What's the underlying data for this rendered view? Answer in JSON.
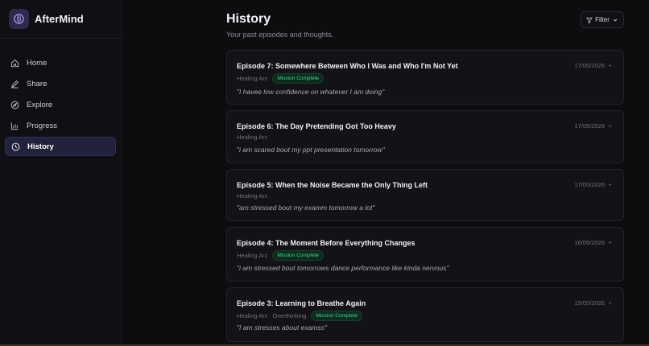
{
  "app": {
    "name": "AfterMind"
  },
  "sidebar": {
    "items": [
      {
        "label": "Home",
        "icon": "home-icon"
      },
      {
        "label": "Share",
        "icon": "pencil-icon"
      },
      {
        "label": "Explore",
        "icon": "compass-icon"
      },
      {
        "label": "Progress",
        "icon": "bar-chart-icon"
      },
      {
        "label": "History",
        "icon": "clock-icon",
        "active": true
      }
    ]
  },
  "header": {
    "title": "History",
    "subtitle": "Your past episodes and thoughts.",
    "filter_label": "Filter"
  },
  "episodes": [
    {
      "title": "Episode 7: Somewhere Between Who I Was and Who I'm Not Yet",
      "date": "17/05/2026",
      "tags": [
        "Healing Arc"
      ],
      "badge": "Mission Complete",
      "quote": "\"I havee low confidence on whatever I am doing\""
    },
    {
      "title": "Episode 6: The Day Pretending Got Too Heavy",
      "date": "17/05/2026",
      "tags": [
        "Healing Arc"
      ],
      "badge": "",
      "quote": "\"i am scared bout my ppt presentation tomorrow\""
    },
    {
      "title": "Episode 5: When the Noise Became the Only Thing Left",
      "date": "17/05/2026",
      "tags": [
        "Healing Arc"
      ],
      "badge": "",
      "quote": "\"am stressed bout my examm tomorrow a lot\""
    },
    {
      "title": "Episode 4: The Moment Before Everything Changes",
      "date": "16/05/2026",
      "tags": [
        "Healing Arc"
      ],
      "badge": "Mission Complete",
      "quote": "\"i am stressed bout tomorrows dance performance like kinda nervous\""
    },
    {
      "title": "Episode 3: Learning to Breathe Again",
      "date": "15/05/2026",
      "tags": [
        "Healing Arc",
        "Overthinking"
      ],
      "badge": "Mission Complete",
      "quote": "\"I am stresses about examss\""
    }
  ],
  "colors": {
    "accent": "#21233c",
    "badge_green": "#3fd58b",
    "background": "#0d0d10"
  }
}
